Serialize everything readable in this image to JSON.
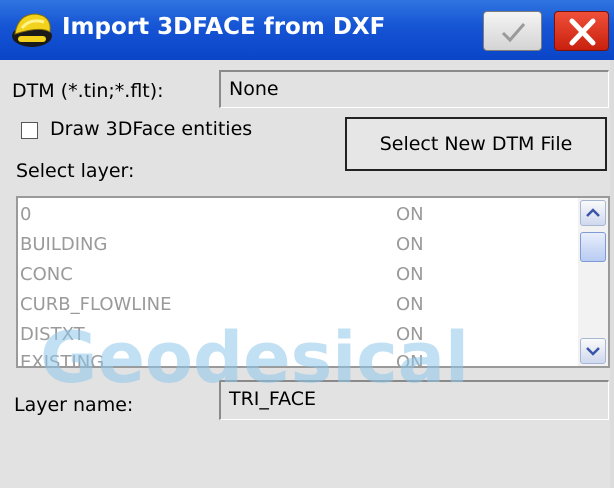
{
  "window": {
    "title": "Import 3DFACE from DXF",
    "app_icon": "helmet-icon",
    "ok_icon": "checkmark-icon",
    "close_icon": "close-x-icon"
  },
  "dtm": {
    "label": "DTM (*.tin;*.flt):",
    "value": "None"
  },
  "draw_3dface": {
    "label": "Draw 3DFace entities",
    "checked": false
  },
  "select_dtm_button": {
    "label": "Select New DTM File"
  },
  "layers": {
    "label": "Select layer:",
    "rows": [
      {
        "name": "0",
        "status": "ON"
      },
      {
        "name": "BUILDING",
        "status": "ON"
      },
      {
        "name": "CONC",
        "status": "ON"
      },
      {
        "name": "CURB_FLOWLINE",
        "status": "ON"
      },
      {
        "name": "DISTXT",
        "status": "ON"
      },
      {
        "name": "EXISTING",
        "status": "ON"
      }
    ]
  },
  "layer_name": {
    "label": "Layer name:",
    "value": "TRI_FACE"
  },
  "watermark": {
    "text": "Geodesical"
  },
  "colors": {
    "titlebar": "#1554d4",
    "close": "#d8301a",
    "watermark": "#8ec7ea"
  }
}
